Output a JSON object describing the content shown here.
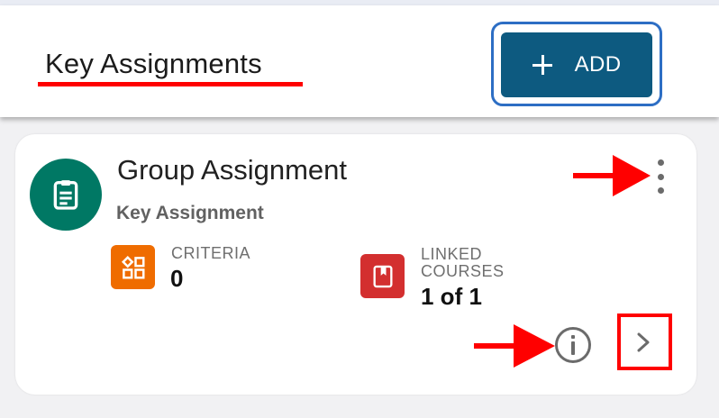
{
  "header": {
    "title": "Key Assignments",
    "add_button": {
      "label": "ADD",
      "icon": "plus-icon"
    }
  },
  "card": {
    "title": "Group Assignment",
    "subtitle": "Key Assignment",
    "avatar_icon": "clipboard-icon",
    "menu_icon": "more-vert-icon",
    "stats": {
      "criteria": {
        "label": "CRITERIA",
        "value": "0",
        "icon": "category-icon"
      },
      "linked_courses": {
        "label": "LINKED COURSES",
        "value": "1 of 1",
        "icon": "book-icon"
      }
    },
    "info_icon": "info-icon",
    "open_icon": "chevron-right-icon"
  },
  "colors": {
    "header_bg": "#ffffff",
    "page_bg": "#f1f1f3",
    "add_button": "#0d5a80",
    "add_button_highlight": "#2d6ec4",
    "avatar": "#007864",
    "criteria_icon_bg": "#ef6c00",
    "courses_icon_bg": "#d32f2f",
    "annotation": "#ff0000"
  }
}
